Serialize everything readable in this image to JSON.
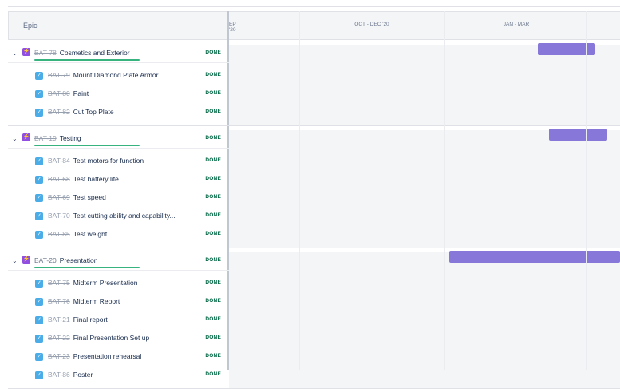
{
  "header": {
    "epic_col": "Epic"
  },
  "timeline": {
    "months": [
      "EP '20",
      "OCT - DEC '20",
      "JAN - MAR"
    ]
  },
  "epics": [
    {
      "key": "BAT-78",
      "summary": "Cosmetics and Exterior",
      "status": "DONE",
      "key_strike": true,
      "tasks": [
        {
          "key": "BAT-79",
          "summary": "Mount Diamond Plate Armor",
          "status": "DONE"
        },
        {
          "key": "BAT-80",
          "summary": "Paint",
          "status": "DONE"
        },
        {
          "key": "BAT-82",
          "summary": "Cut Top Plate",
          "status": "DONE"
        }
      ]
    },
    {
      "key": "BAT-19",
      "summary": "Testing",
      "status": "DONE",
      "key_strike": true,
      "tasks": [
        {
          "key": "BAT-84",
          "summary": "Test motors for function",
          "status": "DONE"
        },
        {
          "key": "BAT-68",
          "summary": "Test battery life",
          "status": "DONE"
        },
        {
          "key": "BAT-69",
          "summary": "Test speed",
          "status": "DONE"
        },
        {
          "key": "BAT-70",
          "summary": "Test cutting ability and capability...",
          "status": "DONE"
        },
        {
          "key": "BAT-85",
          "summary": "Test weight",
          "status": "DONE"
        }
      ]
    },
    {
      "key": "BAT-20",
      "summary": "Presentation",
      "status": "DONE",
      "key_strike": false,
      "tasks": [
        {
          "key": "BAT-75",
          "summary": "Midterm Presentation",
          "status": "DONE"
        },
        {
          "key": "BAT-76",
          "summary": "Midterm Report",
          "status": "DONE"
        },
        {
          "key": "BAT-21",
          "summary": "Final report",
          "status": "DONE"
        },
        {
          "key": "BAT-22",
          "summary": "Final Presentation Set up",
          "status": "DONE"
        },
        {
          "key": "BAT-23",
          "summary": "Presentation rehearsal",
          "status": "DONE"
        },
        {
          "key": "BAT-86",
          "summary": "Poster",
          "status": "DONE"
        }
      ]
    }
  ],
  "colors": {
    "epic": "#904ee2",
    "task": "#4bade8",
    "bar": "#8777d9",
    "done": "#006644",
    "progress": "#36b37e"
  }
}
